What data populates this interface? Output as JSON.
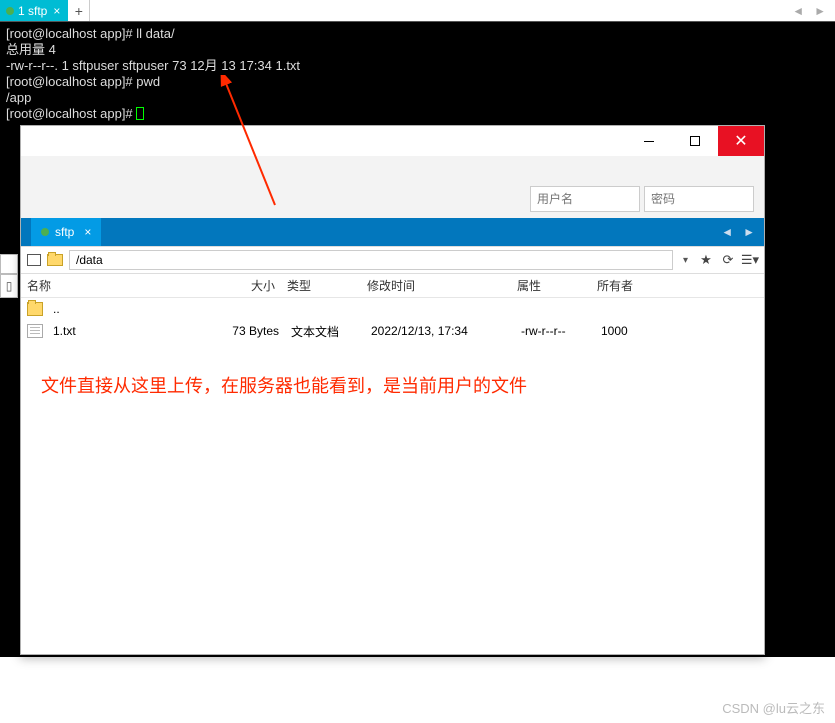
{
  "term_tab": {
    "label": "1 sftp"
  },
  "terminal_lines": {
    "l0": "[root@localhost app]# ll data/",
    "l1": "总用量 4",
    "l2": "-rw-r--r--. 1 sftpuser sftpuser 73 12月 13 17:34 1.txt",
    "l3": "[root@localhost app]# pwd",
    "l4": "/app",
    "l5": "[root@localhost app]# "
  },
  "sftp": {
    "tab_label": "sftp",
    "path": "/data",
    "creds": {
      "user_ph": "用户名",
      "pass_ph": "密码"
    },
    "headers": {
      "name": "名称",
      "size": "大小",
      "type": "类型",
      "date": "修改时间",
      "attr": "属性",
      "owner": "所有者"
    },
    "rows": [
      {
        "name": "..",
        "size": "",
        "type": "",
        "date": "",
        "attr": "",
        "owner": "",
        "icon": "folder"
      },
      {
        "name": "1.txt",
        "size": "73 Bytes",
        "type": "文本文档",
        "date": "2022/12/13, 17:34",
        "attr": "-rw-r--r--",
        "owner": "1000",
        "icon": "file"
      }
    ]
  },
  "annotation": "文件直接从这里上传，在服务器也能看到，是当前用户的文件",
  "watermark": "CSDN @lu云之东",
  "colors": {
    "tab_blue": "#00bcd4",
    "sftp_bar": "#0277bd",
    "close_red": "#e81123",
    "anno": "#ff2a00"
  }
}
